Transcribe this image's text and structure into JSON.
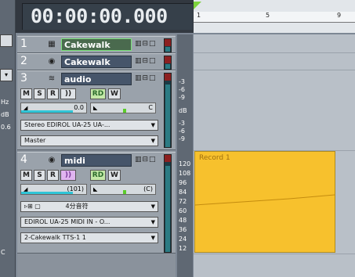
{
  "transport": {
    "time": "00:00:00.000"
  },
  "left_strip": {
    "items": [
      "Hz",
      "dB",
      "0.6",
      "C"
    ]
  },
  "tracks": [
    {
      "number": "1",
      "name": "Cakewalk"
    },
    {
      "number": "2",
      "name": "Cakewalk"
    },
    {
      "number": "3",
      "name": "audio",
      "buttons": [
        "M",
        "S",
        "R",
        "))",
        "RD",
        "W"
      ],
      "volume": "0.0",
      "pan": "C",
      "input": "Stereo EDIROL UA-25 UA-...",
      "output": "Master"
    },
    {
      "number": "4",
      "name": "midi",
      "buttons": [
        "M",
        "S",
        "R",
        "))",
        "RD",
        "W"
      ],
      "volume": "(101)",
      "pan": "(C)",
      "quantize": "4分音符",
      "input": "EDIROL UA-25 MIDI IN - O...",
      "output": "2-Cakewalk TTS-1 1"
    }
  ],
  "db_ruler": [
    "-3",
    "-6",
    "-9",
    "-3",
    "-6",
    "-9"
  ],
  "db_unit": "dB",
  "midi_ruler": [
    "120",
    "108",
    "96",
    "84",
    "72",
    "60",
    "48",
    "36",
    "24",
    "12"
  ],
  "timeline": {
    "markers": [
      "1",
      "5",
      "9"
    ]
  },
  "clip": {
    "label": "Record 1"
  }
}
